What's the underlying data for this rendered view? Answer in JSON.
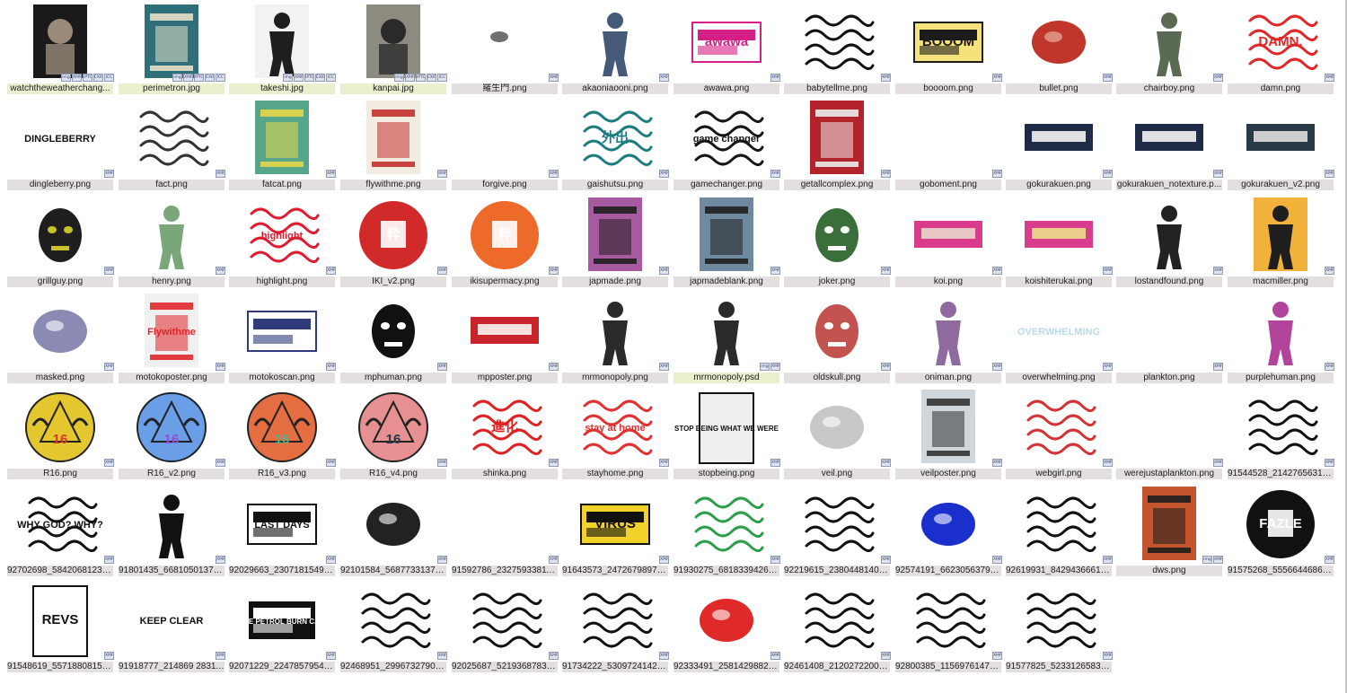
{
  "window": {
    "title": ""
  },
  "tiles": [
    {
      "name": "watchtheweatherchang...",
      "art": "photo",
      "c1": "#1a1a1a",
      "c2": "#9a8a7a",
      "badges": [
        "img",
        "XMP",
        "IPTC",
        "EXIF",
        "ICC"
      ],
      "sel": true
    },
    {
      "name": "perimetron.jpg",
      "art": "poster",
      "c1": "#2e6f7a",
      "c2": "#e6e0c8",
      "badges": [
        "img",
        "XMP",
        "IPTC",
        "EXIF",
        "ICC"
      ],
      "sel": true
    },
    {
      "name": "takeshi.jpg",
      "art": "figure",
      "c1": "#f2f2f0",
      "c2": "#1e1e1e",
      "badges": [
        "img",
        "XMP",
        "IPTC",
        "EXIF",
        "ICC"
      ],
      "sel": true
    },
    {
      "name": "kanpai.jpg",
      "art": "photo",
      "c1": "#8d8a80",
      "c2": "#2a2a2a",
      "badges": [
        "img",
        "XMP",
        "IPTC",
        "EXIF",
        "ICC"
      ],
      "sel": true
    },
    {
      "name": "羅生門.png",
      "art": "shape",
      "c1": "#111111",
      "c2": "#ffffff",
      "badges": [
        "XMP"
      ],
      "sel": false
    },
    {
      "name": "akaoniaooni.png",
      "art": "figure",
      "c1": "#ffffff",
      "c2": "#445a78",
      "badges": [
        "XMP"
      ],
      "sel": false
    },
    {
      "name": "awawa.png",
      "art": "block",
      "c1": "#ffffff",
      "c2": "#d61f86",
      "badges": [
        "XMP"
      ],
      "sel": false
    },
    {
      "name": "babytellme.png",
      "art": "scribble",
      "c1": "#ffffff",
      "c2": "#111111",
      "badges": [
        "XMP"
      ],
      "sel": false
    },
    {
      "name": "boooom.png",
      "art": "block",
      "c1": "#f6e27a",
      "c2": "#1c1c1c",
      "badges": [
        "XMP"
      ],
      "sel": false
    },
    {
      "name": "bullet.png",
      "art": "shape",
      "c1": "#e9c6b4",
      "c2": "#c0362b",
      "badges": [
        "XMP"
      ],
      "sel": false
    },
    {
      "name": "chairboy.png",
      "art": "figure",
      "c1": "#ffffff",
      "c2": "#5b6a52",
      "badges": [
        "XMP"
      ],
      "sel": false
    },
    {
      "name": "damn.png",
      "art": "scribble",
      "c1": "#ffffff",
      "c2": "#e02727",
      "badges": [
        "XMP"
      ],
      "sel": false
    },
    {
      "name": "dingleberry.png",
      "art": "text",
      "c1": "#ffffff",
      "c2": "#111111",
      "badges": [
        "XMP"
      ],
      "sel": false
    },
    {
      "name": "fact.png",
      "art": "scribble",
      "c1": "#ffffff",
      "c2": "#333333",
      "badges": [
        "XMP"
      ],
      "sel": false
    },
    {
      "name": "fatcat.png",
      "art": "poster",
      "c1": "#57a689",
      "c2": "#e5d84a",
      "badges": [
        "XMP"
      ],
      "sel": false
    },
    {
      "name": "flywithme.png",
      "art": "poster",
      "c1": "#f2ece2",
      "c2": "#c4322c",
      "badges": [
        "XMP"
      ],
      "sel": false
    },
    {
      "name": "forgive.png",
      "art": "blank",
      "c1": "#ffffff",
      "c2": "#ffffff",
      "badges": [
        "XMP"
      ],
      "sel": false
    },
    {
      "name": "gaishutsu.png",
      "art": "scribble",
      "c1": "#ffffff",
      "c2": "#1b7d7f",
      "badges": [
        "XMP"
      ],
      "sel": false
    },
    {
      "name": "gamechanger.png",
      "art": "scribble",
      "c1": "#ffffff",
      "c2": "#151515",
      "badges": [
        "XMP"
      ],
      "sel": false
    },
    {
      "name": "getallcomplex.png",
      "art": "poster",
      "c1": "#b3232b",
      "c2": "#ececec",
      "badges": [
        "XMP"
      ],
      "sel": false
    },
    {
      "name": "goboment.png",
      "art": "blank",
      "c1": "#ffffff",
      "c2": "#ffffff",
      "badges": [
        "XMP"
      ],
      "sel": false
    },
    {
      "name": "gokurakuen.png",
      "art": "banner",
      "c1": "#1f2a47",
      "c2": "#ffffff",
      "badges": [
        "XMP"
      ],
      "sel": false
    },
    {
      "name": "gokurakuen_notexture.p...",
      "art": "banner",
      "c1": "#1f2a47",
      "c2": "#ffffff",
      "badges": [
        "XMP"
      ],
      "sel": false
    },
    {
      "name": "gokurakuen_v2.png",
      "art": "banner",
      "c1": "#283a46",
      "c2": "#e8e8e8",
      "badges": [
        "XMP"
      ],
      "sel": false
    },
    {
      "name": "grillguy.png",
      "art": "face",
      "c1": "#c9c12b",
      "c2": "#1e1e1e",
      "badges": [
        "XMP"
      ],
      "sel": false
    },
    {
      "name": "henry.png",
      "art": "figure",
      "c1": "#ffffff",
      "c2": "#7aa77a",
      "badges": [
        "XMP"
      ],
      "sel": false
    },
    {
      "name": "highlight.png",
      "art": "scribble",
      "c1": "#ffffff",
      "c2": "#e11b2f",
      "badges": [
        "XMP"
      ],
      "sel": false
    },
    {
      "name": "IKI_v2.png",
      "art": "circle",
      "c1": "#d22a2a",
      "c2": "#ffffff",
      "badges": [
        "XMP"
      ],
      "sel": false
    },
    {
      "name": "ikisupermacy.png",
      "art": "circle",
      "c1": "#ee6a2a",
      "c2": "#ffffff",
      "badges": [
        "XMP"
      ],
      "sel": false
    },
    {
      "name": "japmade.png",
      "art": "poster",
      "c1": "#a75aa0",
      "c2": "#1f1f1f",
      "badges": [
        "XMP"
      ],
      "sel": false
    },
    {
      "name": "japmadeblank.png",
      "art": "poster",
      "c1": "#6f8aa0",
      "c2": "#1f1f1f",
      "badges": [
        "XMP"
      ],
      "sel": false
    },
    {
      "name": "joker.png",
      "art": "face",
      "c1": "#ffffff",
      "c2": "#3a6e3a",
      "badges": [
        "XMP"
      ],
      "sel": false
    },
    {
      "name": "koi.png",
      "art": "banner",
      "c1": "#d93c8c",
      "c2": "#e9e1cf",
      "badges": [
        "XMP"
      ],
      "sel": false
    },
    {
      "name": "koishiterukai.png",
      "art": "banner",
      "c1": "#d93c8c",
      "c2": "#f0e68c",
      "badges": [
        "XMP"
      ],
      "sel": false
    },
    {
      "name": "lostandfound.png",
      "art": "figure",
      "c1": "#ffffff",
      "c2": "#222222",
      "badges": [
        "XMP"
      ],
      "sel": false
    },
    {
      "name": "macmiller.png",
      "art": "figure",
      "c1": "#f2b13a",
      "c2": "#1e1e1e",
      "badges": [
        "XMP"
      ],
      "sel": false
    },
    {
      "name": "masked.png",
      "art": "shape",
      "c1": "#ffffff",
      "c2": "#8a8ab5",
      "badges": [
        "XMP"
      ],
      "sel": false
    },
    {
      "name": "motokoposter.png",
      "art": "poster",
      "c1": "#f0f0f0",
      "c2": "#e0262b",
      "badges": [
        "XMP"
      ],
      "sel": false
    },
    {
      "name": "motokoscan.png",
      "art": "block",
      "c1": "#ffffff",
      "c2": "#2f3b7a",
      "badges": [
        "XMP"
      ],
      "sel": false
    },
    {
      "name": "mphuman.png",
      "art": "face",
      "c1": "#ffffff",
      "c2": "#111111",
      "badges": [
        "XMP"
      ],
      "sel": false
    },
    {
      "name": "mpposter.png",
      "art": "banner",
      "c1": "#c9232b",
      "c2": "#ffffff",
      "badges": [
        "XMP"
      ],
      "sel": false
    },
    {
      "name": "mrmonopoly.png",
      "art": "figure",
      "c1": "#ffffff",
      "c2": "#2a2a2a",
      "badges": [
        "XMP"
      ],
      "sel": false
    },
    {
      "name": "mrmonopoly.psd",
      "art": "figure",
      "c1": "#ffffff",
      "c2": "#2a2a2a",
      "badges": [
        "img",
        "XMP"
      ],
      "sel": true
    },
    {
      "name": "oldskull.png",
      "art": "face",
      "c1": "#ffffff",
      "c2": "#c2534f",
      "badges": [
        "XMP"
      ],
      "sel": false
    },
    {
      "name": "oniman.png",
      "art": "figure",
      "c1": "#ffffff",
      "c2": "#8e6a9e",
      "badges": [
        "XMP"
      ],
      "sel": false
    },
    {
      "name": "overwhelming.png",
      "art": "text",
      "c1": "#ffffff",
      "c2": "#b8dcec",
      "badges": [
        "XMP"
      ],
      "sel": false
    },
    {
      "name": "plankton.png",
      "art": "blank",
      "c1": "#ffffff",
      "c2": "#ffffff",
      "badges": [
        "XMP"
      ],
      "sel": false
    },
    {
      "name": "purplehuman.png",
      "art": "figure",
      "c1": "#ffffff",
      "c2": "#b3449b",
      "badges": [
        "XMP"
      ],
      "sel": false
    },
    {
      "name": "R16.png",
      "art": "badge",
      "c1": "#e4c72e",
      "c2": "#d4392a",
      "badges": [
        "XMP"
      ],
      "sel": false
    },
    {
      "name": "R16_v2.png",
      "art": "badge",
      "c1": "#6a9fe8",
      "c2": "#9a4bd0",
      "badges": [
        "XMP"
      ],
      "sel": false
    },
    {
      "name": "R16_v3.png",
      "art": "badge",
      "c1": "#e46d41",
      "c2": "#4fb38e",
      "badges": [
        "XMP"
      ],
      "sel": false
    },
    {
      "name": "R16_v4.png",
      "art": "badge",
      "c1": "#e79092",
      "c2": "#22384e",
      "badges": [
        "XMP"
      ],
      "sel": false
    },
    {
      "name": "shinka.png",
      "art": "scribble",
      "c1": "#ffffff",
      "c2": "#e02020",
      "badges": [
        "XMP"
      ],
      "sel": false
    },
    {
      "name": "stayhome.png",
      "art": "scribble",
      "c1": "#ffffff",
      "c2": "#e23030",
      "badges": [
        "XMP"
      ],
      "sel": false
    },
    {
      "name": "stopbeing.png",
      "art": "sign",
      "c1": "#eeeeee",
      "c2": "#111111",
      "badges": [
        "XMP"
      ],
      "sel": false
    },
    {
      "name": "veil.png",
      "art": "shape",
      "c1": "#ffffff",
      "c2": "#c8c8c8",
      "badges": [
        "XMP"
      ],
      "sel": false
    },
    {
      "name": "veilposter.png",
      "art": "poster",
      "c1": "#cfd6dc",
      "c2": "#333333",
      "badges": [
        "XMP"
      ],
      "sel": false
    },
    {
      "name": "webgirl.png",
      "art": "scribble",
      "c1": "#ffffff",
      "c2": "#d43131",
      "badges": [
        "XMP"
      ],
      "sel": false
    },
    {
      "name": "werejustaplankton.png",
      "art": "blank",
      "c1": "#ffffff",
      "c2": "#ffffff",
      "badges": [
        "XMP"
      ],
      "sel": false
    },
    {
      "name": "91544528_214276563174...",
      "art": "scribble",
      "c1": "#ffffff",
      "c2": "#111111",
      "badges": [
        "XMP"
      ],
      "sel": false
    },
    {
      "name": "92702698_584206812303...",
      "art": "scribble",
      "c1": "#ffffff",
      "c2": "#111111",
      "badges": [
        "XMP"
      ],
      "sel": false
    },
    {
      "name": "91801435_668105013735...",
      "art": "figure",
      "c1": "#ffffff",
      "c2": "#111111",
      "badges": [
        "XMP"
      ],
      "sel": false
    },
    {
      "name": "92029663_230718154964...",
      "art": "block",
      "c1": "#ffffff",
      "c2": "#111111",
      "badges": [
        "XMP"
      ],
      "sel": false
    },
    {
      "name": "92101584_568773313753...",
      "art": "shape",
      "c1": "#ffffff",
      "c2": "#222222",
      "badges": [
        "XMP"
      ],
      "sel": false
    },
    {
      "name": "91592786_232759338110...",
      "art": "blank",
      "c1": "#ffffff",
      "c2": "#ffffff",
      "badges": [
        "XMP"
      ],
      "sel": false
    },
    {
      "name": "91643573_247267989730...",
      "art": "block",
      "c1": "#f2d22a",
      "c2": "#111111",
      "badges": [
        "XMP"
      ],
      "sel": false
    },
    {
      "name": "91930275_681833942642...",
      "art": "scribble",
      "c1": "#ffffff",
      "c2": "#2aa04a",
      "badges": [
        "XMP"
      ],
      "sel": false
    },
    {
      "name": "92219615_238044814044...",
      "art": "scribble",
      "c1": "#ffffff",
      "c2": "#111111",
      "badges": [
        "XMP"
      ],
      "sel": false
    },
    {
      "name": "92574191_662305637900...",
      "art": "shape",
      "c1": "#ffffff",
      "c2": "#1a2fcc",
      "badges": [
        "XMP"
      ],
      "sel": false
    },
    {
      "name": "92619931_842943666184...",
      "art": "scribble",
      "c1": "#ffffff",
      "c2": "#111111",
      "badges": [
        "XMP"
      ],
      "sel": false
    },
    {
      "name": "dws.png",
      "art": "poster",
      "c1": "#c4552e",
      "c2": "#1e1e1e",
      "badges": [
        "img",
        "XMP"
      ],
      "sel": false
    },
    {
      "name": "91575268_555664468636...",
      "art": "circle",
      "c1": "#111111",
      "c2": "#ffffff",
      "badges": [
        "XMP"
      ],
      "sel": false
    },
    {
      "name": "91548619_557188081569...",
      "art": "sign",
      "c1": "#ffffff",
      "c2": "#111111",
      "badges": [
        "XMP"
      ],
      "sel": false
    },
    {
      "name": "91918777_214869 28311...",
      "art": "text",
      "c1": "#ffffff",
      "c2": "#111111",
      "badges": [
        "XMP"
      ],
      "sel": false
    },
    {
      "name": "92071229_224785795430...",
      "art": "block",
      "c1": "#111111",
      "c2": "#ffffff",
      "badges": [
        "XMP"
      ],
      "sel": false
    },
    {
      "name": "92468951_299673279034...",
      "art": "scribble",
      "c1": "#ffffff",
      "c2": "#111111",
      "badges": [
        "XMP"
      ],
      "sel": false
    },
    {
      "name": "92025687_521936878396...",
      "art": "scribble",
      "c1": "#ffffff",
      "c2": "#111111",
      "badges": [
        "XMP"
      ],
      "sel": false
    },
    {
      "name": "91734222_530972414225...",
      "art": "scribble",
      "c1": "#ffffff",
      "c2": "#111111",
      "badges": [
        "XMP"
      ],
      "sel": false
    },
    {
      "name": "92333491_258142988218...",
      "art": "shape",
      "c1": "#ffffff",
      "c2": "#e02a2a",
      "badges": [
        "XMP"
      ],
      "sel": false
    },
    {
      "name": "92461408_212027220054...",
      "art": "scribble",
      "c1": "#ffffff",
      "c2": "#111111",
      "badges": [
        "XMP"
      ],
      "sel": false
    },
    {
      "name": "92800385_115697614798...",
      "art": "scribble",
      "c1": "#ffffff",
      "c2": "#111111",
      "badges": [
        "XMP"
      ],
      "sel": false
    },
    {
      "name": "91577825_523312658334...",
      "art": "scribble",
      "c1": "#ffffff",
      "c2": "#111111",
      "badges": [
        "XMP"
      ],
      "sel": false
    }
  ],
  "thumb_text": {
    "awawa.png": "awawa",
    "boooom.png": "BOOOM",
    "damn.png": "DAMN.",
    "dingleberry.png": "DINGLEBERRY",
    "flywithme.png": "",
    "motokoposter.png": "Flywithme",
    "overwhelming.png": "OVERWHELMING",
    "stopbeing.png": "STOP BEING WHAT WE WERE",
    "91643573_247267989730...": "VIRUS",
    "92029663_230718154964...": "LAST DAYS",
    "91918777_214869 28311...": "KEEP CLEAR",
    "92071229_224785795430...": "SAVE PETROL BURN CARS",
    "91548619_557188081569...": "REVS",
    "91575268_555664468636...": "FAZLE",
    "R16.png": "16",
    "R16_v2.png": "16",
    "R16_v3.png": "16",
    "R16_v4.png": "16",
    "IKI_v2.png": "粋",
    "ikisupermacy.png": "粋",
    "shinka.png": "進化",
    "92702698_584206812303...": "WHY GOD? WHY?",
    "gamechanger.png": "game changer",
    "highlight.png": "highlight",
    "gaishutsu.png": "外出",
    "stayhome.png": "stay at home"
  }
}
